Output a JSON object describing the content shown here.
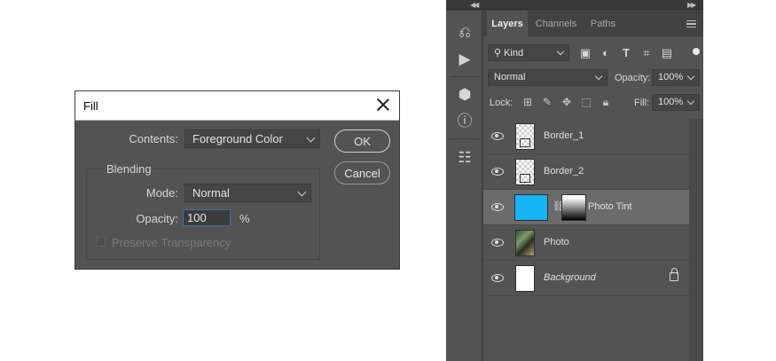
{
  "fill_dialog": {
    "title": "Fill",
    "contents_label": "Contents:",
    "contents_value": "Foreground Color",
    "ok_label": "OK",
    "cancel_label": "Cancel",
    "blending_label": "Blending",
    "mode_label": "Mode:",
    "mode_value": "Normal",
    "opacity_label": "Opacity:",
    "opacity_value": "100",
    "opacity_unit": "%",
    "preserve_label": "Preserve Transparency"
  },
  "layers_panel": {
    "tabs": [
      {
        "label": "Layers",
        "active": true
      },
      {
        "label": "Channels",
        "active": false
      },
      {
        "label": "Paths",
        "active": false
      }
    ],
    "filter_kind": "Kind",
    "filter_icons": [
      "image-filter-icon",
      "adjustment-filter-icon",
      "type-filter-icon",
      "shape-filter-icon",
      "smart-object-filter-icon"
    ],
    "blend_mode": "Normal",
    "opacity_label": "Opacity:",
    "opacity_value": "100%",
    "lock_label": "Lock:",
    "fill_label": "Fill:",
    "fill_value": "100%",
    "layers": [
      {
        "name": "Border_1",
        "thumb": "checker"
      },
      {
        "name": "Border_2",
        "thumb": "checker"
      },
      {
        "name": "Photo Tint",
        "thumb": "adjustment",
        "selected": true
      },
      {
        "name": "Photo",
        "thumb": "photo"
      },
      {
        "name": "Background",
        "thumb": "white",
        "locked": true
      }
    ]
  },
  "colors": {
    "panel_bg": "#535353",
    "selected_row": "#6b6b6b",
    "tint_color": "#14b4f4",
    "focus_border": "#3e6fa8"
  }
}
